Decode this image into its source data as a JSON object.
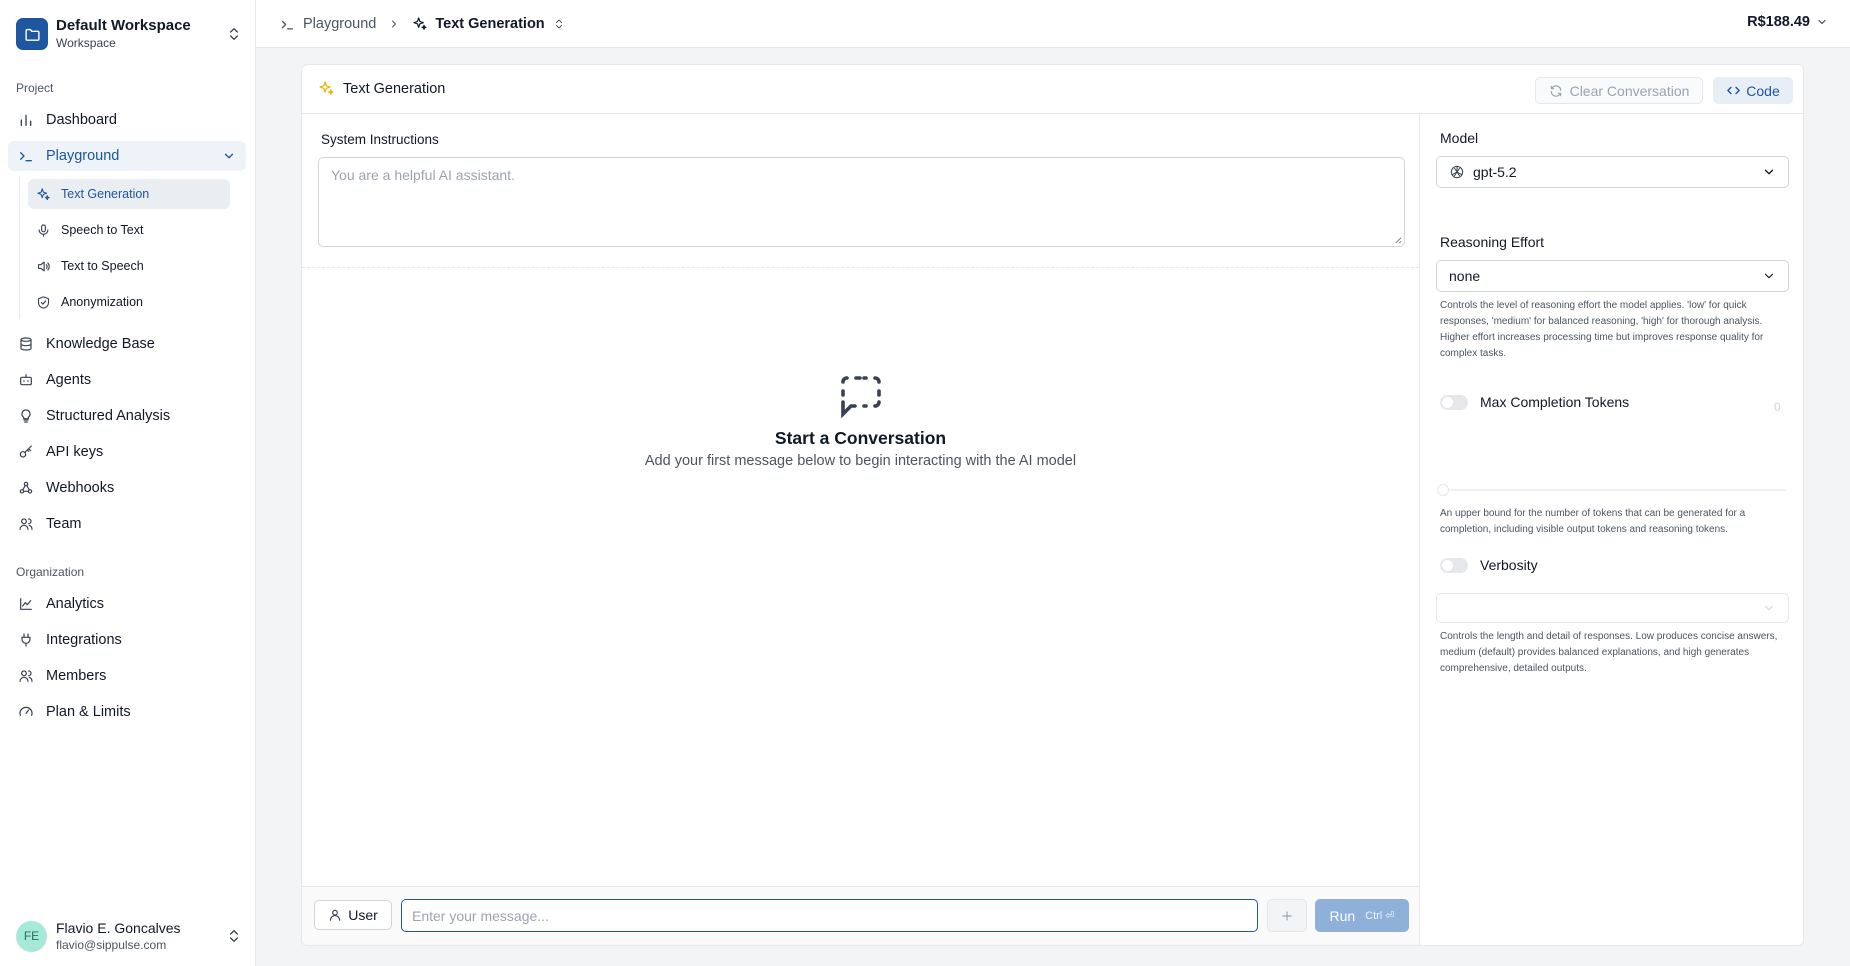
{
  "workspace": {
    "name": "Default Workspace",
    "subtitle": "Workspace"
  },
  "sidebar": {
    "project_label": "Project",
    "org_label": "Organization",
    "dashboard": "Dashboard",
    "playground": "Playground",
    "playground_sub": [
      "Text Generation",
      "Speech to Text",
      "Text to Speech",
      "Anonymization"
    ],
    "project_items": [
      "Knowledge Base",
      "Agents",
      "Structured Analysis",
      "API keys",
      "Webhooks",
      "Team"
    ],
    "org_items": [
      "Analytics",
      "Integrations",
      "Members",
      "Plan & Limits"
    ]
  },
  "user": {
    "initials": "FE",
    "name": "Flavio E. Goncalves",
    "email": "flavio@sippulse.com"
  },
  "breadcrumb": {
    "parent": "Playground",
    "current": "Text Generation"
  },
  "balance": "R$188.49",
  "panel": {
    "title": "Text Generation",
    "clear_label": "Clear Conversation",
    "code_label": "Code",
    "system_label": "System Instructions",
    "system_placeholder": "You are a helpful AI assistant.",
    "empty_title": "Start a Conversation",
    "empty_subtitle": "Add your first message below to begin interacting with the AI model",
    "role_label": "User",
    "message_placeholder": "Enter your message...",
    "run_label": "Run",
    "run_shortcut": "Ctrl ⏎"
  },
  "settings": {
    "model_label": "Model",
    "model_value": "gpt-5.2",
    "reasoning_label": "Reasoning Effort",
    "reasoning_value": "none",
    "reasoning_help": "Controls the level of reasoning effort the model applies. 'low' for quick responses, 'medium' for balanced reasoning, 'high' for thorough analysis. Higher effort increases processing time but improves response quality for complex tasks.",
    "max_tokens_label": "Max Completion Tokens",
    "max_tokens_value": "0",
    "max_tokens_help": "An upper bound for the number of tokens that can be generated for a completion, including visible output tokens and reasoning tokens.",
    "verbosity_label": "Verbosity",
    "verbosity_value": "",
    "verbosity_help": "Controls the length and detail of responses. Low produces concise answers, medium (default) provides balanced explanations, and high generates comprehensive, detailed outputs."
  },
  "colors": {
    "accent": "#1e56a0",
    "run_button": "#8fb0d8",
    "avatar": "#a7e9d8"
  }
}
